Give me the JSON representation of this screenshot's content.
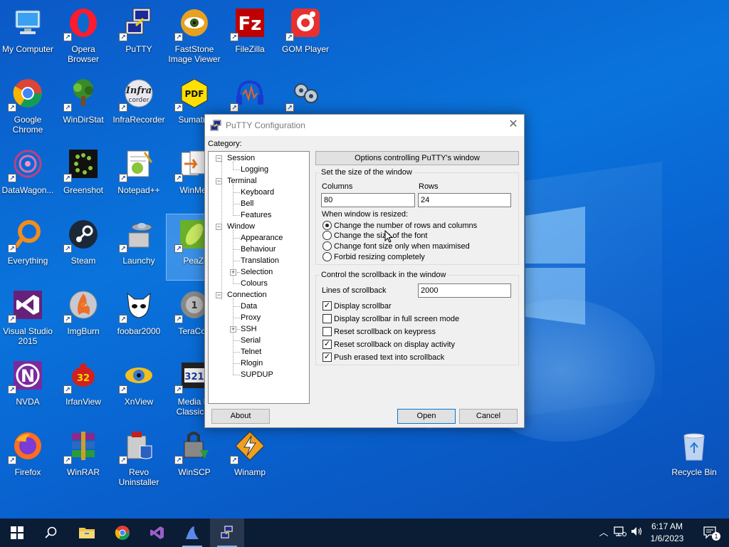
{
  "desktop": {
    "icons": [
      {
        "id": "my-computer",
        "label": "My Computer",
        "icon": "computer-icon"
      },
      {
        "id": "opera",
        "label": "Opera Browser",
        "icon": "opera-icon"
      },
      {
        "id": "putty",
        "label": "PuTTY",
        "icon": "putty-icon"
      },
      {
        "id": "faststone",
        "label": "FastStone Image Viewer",
        "icon": "faststone-icon"
      },
      {
        "id": "filezilla",
        "label": "FileZilla",
        "icon": "filezilla-icon"
      },
      {
        "id": "gom",
        "label": "GOM Player",
        "icon": "gom-player-icon"
      },
      {
        "id": "chrome",
        "label": "Google Chrome",
        "icon": "chrome-icon"
      },
      {
        "id": "windirstat",
        "label": "WinDirStat",
        "icon": "windirstat-icon"
      },
      {
        "id": "infrarecorder",
        "label": "InfraRecorder",
        "icon": "infrarecorder-icon"
      },
      {
        "id": "sumatra",
        "label": "Sumatra",
        "icon": "sumatra-pdf-icon"
      },
      {
        "id": "audacity",
        "label": "",
        "icon": "audacity-icon"
      },
      {
        "id": "unknown-app",
        "label": "",
        "icon": "app-icon"
      },
      {
        "id": "datawagon",
        "label": "DataWagon...",
        "icon": "datawagon-icon"
      },
      {
        "id": "greenshot",
        "label": "Greenshot",
        "icon": "greenshot-icon"
      },
      {
        "id": "notepadpp",
        "label": "Notepad++",
        "icon": "notepadpp-icon"
      },
      {
        "id": "winmerge",
        "label": "WinMer",
        "icon": "winmerge-icon"
      },
      {
        "id": "everything",
        "label": "Everything",
        "icon": "everything-icon"
      },
      {
        "id": "steam",
        "label": "Steam",
        "icon": "steam-icon"
      },
      {
        "id": "launchy",
        "label": "Launchy",
        "icon": "launchy-icon"
      },
      {
        "id": "peazip",
        "label": "PeaZi",
        "icon": "peazip-icon"
      },
      {
        "id": "visualstudio",
        "label": "Visual Studio 2015",
        "icon": "visual-studio-icon"
      },
      {
        "id": "imgburn",
        "label": "ImgBurn",
        "icon": "imgburn-icon"
      },
      {
        "id": "foobar",
        "label": "foobar2000",
        "icon": "foobar2000-icon"
      },
      {
        "id": "teracopy",
        "label": "TeraCop",
        "icon": "teracopy-icon"
      },
      {
        "id": "nvda",
        "label": "NVDA",
        "icon": "nvda-icon"
      },
      {
        "id": "irfanview",
        "label": "IrfanView",
        "icon": "irfanview-icon"
      },
      {
        "id": "xnview",
        "label": "XnView",
        "icon": "xnview-icon"
      },
      {
        "id": "mpc",
        "label": "Media Pl Classic H",
        "icon": "media-player-classic-icon"
      },
      {
        "id": "firefox",
        "label": "Firefox",
        "icon": "firefox-icon"
      },
      {
        "id": "winrar",
        "label": "WinRAR",
        "icon": "winrar-icon"
      },
      {
        "id": "revo",
        "label": "Revo Uninstaller",
        "icon": "revo-uninstaller-icon"
      },
      {
        "id": "winscp",
        "label": "WinSCP",
        "icon": "winscp-icon"
      },
      {
        "id": "winamp",
        "label": "Winamp",
        "icon": "winamp-icon"
      },
      {
        "id": "recycle",
        "label": "Recycle Bin",
        "icon": "recycle-bin-icon"
      }
    ]
  },
  "dialog": {
    "title": "PuTTY Configuration",
    "category_label": "Category:",
    "tree": {
      "session": "Session",
      "logging": "Logging",
      "terminal": "Terminal",
      "keyboard": "Keyboard",
      "bell": "Bell",
      "features": "Features",
      "window": "Window",
      "appearance": "Appearance",
      "behaviour": "Behaviour",
      "translation": "Translation",
      "selection": "Selection",
      "colours": "Colours",
      "connection": "Connection",
      "data": "Data",
      "proxy": "Proxy",
      "ssh": "SSH",
      "serial": "Serial",
      "telnet": "Telnet",
      "rlogin": "Rlogin",
      "supdup": "SUPDUP"
    },
    "header": "Options controlling PuTTY's window",
    "size_group": {
      "title": "Set the size of the window",
      "columns_label": "Columns",
      "columns_value": "80",
      "rows_label": "Rows",
      "rows_value": "24",
      "resize_label": "When window is resized:",
      "options": [
        "Change the number of rows and columns",
        "Change the size of the font",
        "Change font size only when maximised",
        "Forbid resizing completely"
      ]
    },
    "scroll_group": {
      "title": "Control the scrollback in the window",
      "lines_label": "Lines of scrollback",
      "lines_value": "2000",
      "checks": [
        "Display scrollbar",
        "Display scrollbar in full screen mode",
        "Reset scrollback on keypress",
        "Reset scrollback on display activity",
        "Push erased text into scrollback"
      ]
    },
    "buttons": {
      "about": "About",
      "open": "Open",
      "cancel": "Cancel"
    }
  },
  "taskbar": {
    "time": "6:17 AM",
    "date": "1/6/2023",
    "notifications": "1"
  },
  "colors": {
    "desktop": "#0a63c9",
    "taskbar": "#0b1c35",
    "dialog_bg": "#f0f0f0",
    "default_button_border": "#0078d7"
  }
}
